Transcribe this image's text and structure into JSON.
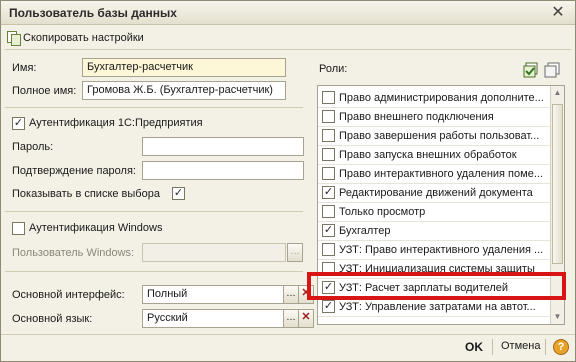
{
  "window": {
    "title": "Пользователь базы данных",
    "close_glyph": "✕"
  },
  "toolbar": {
    "copy_label": "Скопировать настройки",
    "copy_icon": "copy-icon"
  },
  "form": {
    "name_label": "Имя:",
    "name_value": "Бухгалтер-расчетчик",
    "fullname_label": "Полное имя:",
    "fullname_value": "Громова Ж.Б. (Бухгалтер-расчетчик)",
    "auth1c_label": "Аутентификация 1С:Предприятия",
    "auth1c_checked": true,
    "password_label": "Пароль:",
    "password_value": "",
    "confirm_label": "Подтверждение пароля:",
    "confirm_value": "",
    "show_in_list_label": "Показывать в списке выбора",
    "show_in_list_checked": true,
    "auth_windows_label": "Аутентификация Windows",
    "auth_windows_checked": false,
    "windows_user_label": "Пользователь Windows:",
    "windows_user_value": "",
    "main_interface_label": "Основной интерфейс:",
    "main_interface_value": "Полный",
    "main_language_label": "Основной язык:",
    "main_language_value": "Русский",
    "dots_glyph": "...",
    "clear_glyph": "✕",
    "check_glyph": "✓"
  },
  "roles": {
    "label": "Роли:",
    "items": [
      {
        "label": "Право администрирования дополните...",
        "checked": false
      },
      {
        "label": "Право внешнего подключения",
        "checked": false
      },
      {
        "label": "Право завершения работы пользоват...",
        "checked": false
      },
      {
        "label": "Право запуска внешних обработок",
        "checked": false
      },
      {
        "label": "Право интерактивного удаления поме...",
        "checked": false
      },
      {
        "label": "Редактирование движений документа",
        "checked": true
      },
      {
        "label": "Только просмотр",
        "checked": false
      },
      {
        "label": "Бухгалтер",
        "checked": true
      },
      {
        "label": "УЗТ: Право интерактивного удаления ...",
        "checked": false
      },
      {
        "label": "УЗТ: Инициализация системы защиты",
        "checked": false
      },
      {
        "label": "УЗТ: Расчет зарплаты водителей",
        "checked": true
      },
      {
        "label": "УЗТ: Управление затратами на автот...",
        "checked": true
      }
    ]
  },
  "footer": {
    "ok_label": "OK",
    "cancel_label": "Отмена",
    "help_glyph": "?"
  },
  "colors": {
    "highlight_border": "#d81414",
    "window_bg": "#f3f1e6"
  }
}
